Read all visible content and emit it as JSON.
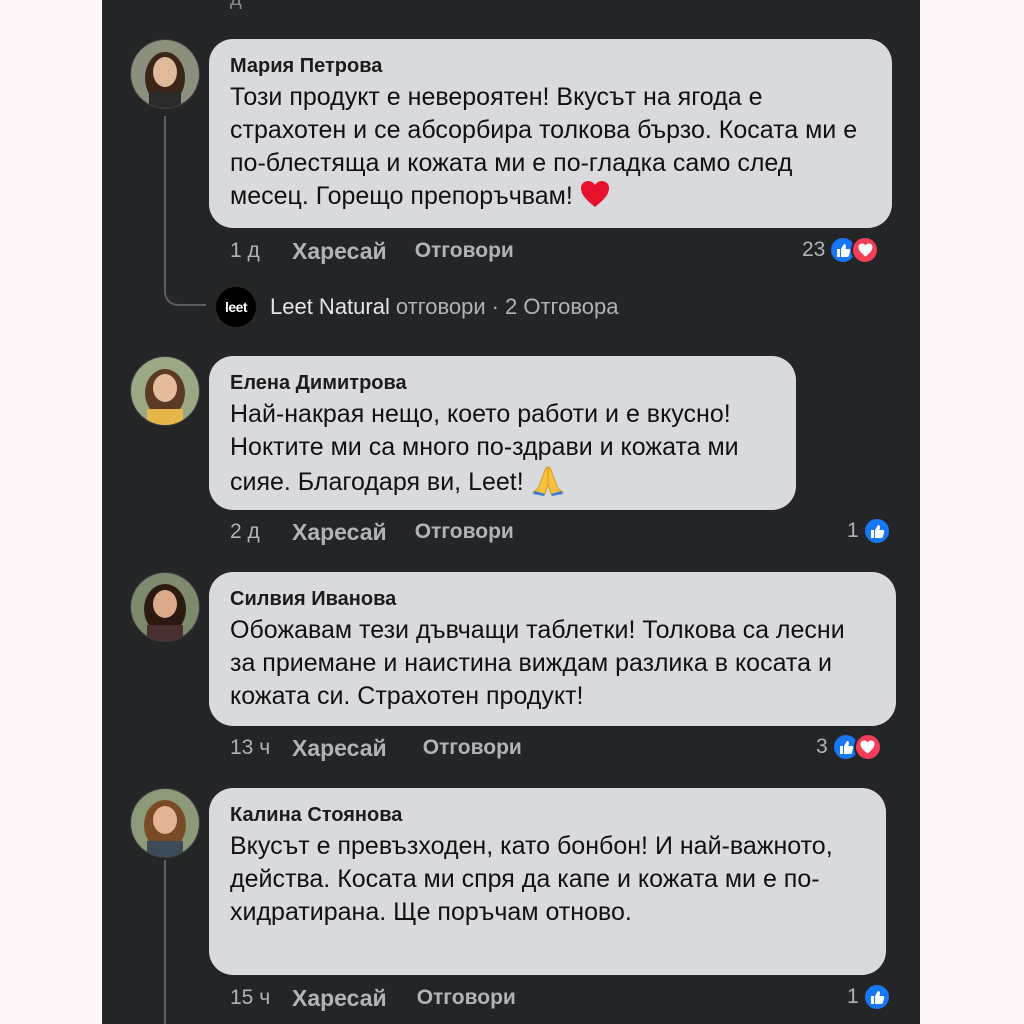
{
  "top_cut_text": "д",
  "comments": [
    {
      "author": "Мария Петрова",
      "text": "Този продукт е невероятен! Вкусът на ягода е страхотен и се абсорбира толкова бързо. Косата ми е по-блестяща и кожата ми е по-гладка само след месец. Горещо препоръчвам!",
      "emoji": "heart",
      "time": "1 д",
      "like_label": "Харесай",
      "reply_label": "Отговори",
      "reaction_count": "23",
      "reactions": [
        "like-icon",
        "love-icon"
      ]
    },
    {
      "author": "Елена Димитрова",
      "text": "Най-накрая нещо, което работи и е вкусно! Ноктите ми са много по-здрави и кожата ми сияе. Благодаря ви, Leet!",
      "emoji": "pray",
      "time": "2 д",
      "like_label": "Харесай",
      "reply_label": "Отговори",
      "reaction_count": "1",
      "reactions": [
        "like-icon"
      ]
    },
    {
      "author": "Силвия Иванова",
      "text": "Обожавам тези дъвчащи таблетки! Толкова са лесни за приемане и наистина виждам разлика в косата и кожата си. Страхотен продукт!",
      "time": "13 ч",
      "like_label": "Харесай",
      "reply_label": "Отговори",
      "reaction_count": "3",
      "reactions": [
        "like-icon",
        "love-icon"
      ]
    },
    {
      "author": "Калина Стоянова",
      "text": "Вкусът е превъзходен, като бонбон! И най-важното, действа. Косата ми спря да капе и кожата ми е по-хидратирана. Ще поръчам отново.",
      "time": "15 ч",
      "like_label": "Харесай",
      "reply_label": "Отговори",
      "reaction_count": "1",
      "reactions": [
        "like-icon"
      ]
    }
  ],
  "reply_summary": {
    "logo_text": "leet",
    "page_name": "Leet Natural",
    "action": "отговори",
    "separator": "·",
    "count_text": "2 Отговора"
  },
  "colors": {
    "panel_bg": "#242526",
    "bubble_bg": "#d9dadd",
    "like_blue": "#1877f2",
    "love_red": "#f33e58",
    "meta_gray": "#b0b3b8"
  }
}
